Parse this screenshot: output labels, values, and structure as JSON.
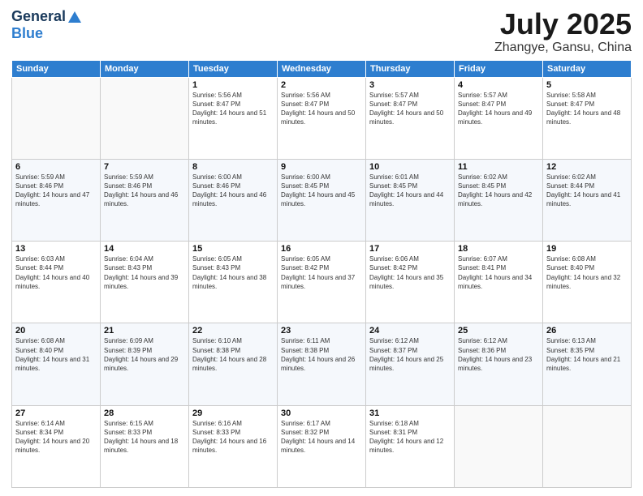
{
  "logo": {
    "general": "General",
    "blue": "Blue"
  },
  "title": {
    "month": "July 2025",
    "location": "Zhangye, Gansu, China"
  },
  "weekdays": [
    "Sunday",
    "Monday",
    "Tuesday",
    "Wednesday",
    "Thursday",
    "Friday",
    "Saturday"
  ],
  "weeks": [
    [
      {
        "day": "",
        "sunrise": "",
        "sunset": "",
        "daylight": ""
      },
      {
        "day": "",
        "sunrise": "",
        "sunset": "",
        "daylight": ""
      },
      {
        "day": "1",
        "sunrise": "Sunrise: 5:56 AM",
        "sunset": "Sunset: 8:47 PM",
        "daylight": "Daylight: 14 hours and 51 minutes."
      },
      {
        "day": "2",
        "sunrise": "Sunrise: 5:56 AM",
        "sunset": "Sunset: 8:47 PM",
        "daylight": "Daylight: 14 hours and 50 minutes."
      },
      {
        "day": "3",
        "sunrise": "Sunrise: 5:57 AM",
        "sunset": "Sunset: 8:47 PM",
        "daylight": "Daylight: 14 hours and 50 minutes."
      },
      {
        "day": "4",
        "sunrise": "Sunrise: 5:57 AM",
        "sunset": "Sunset: 8:47 PM",
        "daylight": "Daylight: 14 hours and 49 minutes."
      },
      {
        "day": "5",
        "sunrise": "Sunrise: 5:58 AM",
        "sunset": "Sunset: 8:47 PM",
        "daylight": "Daylight: 14 hours and 48 minutes."
      }
    ],
    [
      {
        "day": "6",
        "sunrise": "Sunrise: 5:59 AM",
        "sunset": "Sunset: 8:46 PM",
        "daylight": "Daylight: 14 hours and 47 minutes."
      },
      {
        "day": "7",
        "sunrise": "Sunrise: 5:59 AM",
        "sunset": "Sunset: 8:46 PM",
        "daylight": "Daylight: 14 hours and 46 minutes."
      },
      {
        "day": "8",
        "sunrise": "Sunrise: 6:00 AM",
        "sunset": "Sunset: 8:46 PM",
        "daylight": "Daylight: 14 hours and 46 minutes."
      },
      {
        "day": "9",
        "sunrise": "Sunrise: 6:00 AM",
        "sunset": "Sunset: 8:45 PM",
        "daylight": "Daylight: 14 hours and 45 minutes."
      },
      {
        "day": "10",
        "sunrise": "Sunrise: 6:01 AM",
        "sunset": "Sunset: 8:45 PM",
        "daylight": "Daylight: 14 hours and 44 minutes."
      },
      {
        "day": "11",
        "sunrise": "Sunrise: 6:02 AM",
        "sunset": "Sunset: 8:45 PM",
        "daylight": "Daylight: 14 hours and 42 minutes."
      },
      {
        "day": "12",
        "sunrise": "Sunrise: 6:02 AM",
        "sunset": "Sunset: 8:44 PM",
        "daylight": "Daylight: 14 hours and 41 minutes."
      }
    ],
    [
      {
        "day": "13",
        "sunrise": "Sunrise: 6:03 AM",
        "sunset": "Sunset: 8:44 PM",
        "daylight": "Daylight: 14 hours and 40 minutes."
      },
      {
        "day": "14",
        "sunrise": "Sunrise: 6:04 AM",
        "sunset": "Sunset: 8:43 PM",
        "daylight": "Daylight: 14 hours and 39 minutes."
      },
      {
        "day": "15",
        "sunrise": "Sunrise: 6:05 AM",
        "sunset": "Sunset: 8:43 PM",
        "daylight": "Daylight: 14 hours and 38 minutes."
      },
      {
        "day": "16",
        "sunrise": "Sunrise: 6:05 AM",
        "sunset": "Sunset: 8:42 PM",
        "daylight": "Daylight: 14 hours and 37 minutes."
      },
      {
        "day": "17",
        "sunrise": "Sunrise: 6:06 AM",
        "sunset": "Sunset: 8:42 PM",
        "daylight": "Daylight: 14 hours and 35 minutes."
      },
      {
        "day": "18",
        "sunrise": "Sunrise: 6:07 AM",
        "sunset": "Sunset: 8:41 PM",
        "daylight": "Daylight: 14 hours and 34 minutes."
      },
      {
        "day": "19",
        "sunrise": "Sunrise: 6:08 AM",
        "sunset": "Sunset: 8:40 PM",
        "daylight": "Daylight: 14 hours and 32 minutes."
      }
    ],
    [
      {
        "day": "20",
        "sunrise": "Sunrise: 6:08 AM",
        "sunset": "Sunset: 8:40 PM",
        "daylight": "Daylight: 14 hours and 31 minutes."
      },
      {
        "day": "21",
        "sunrise": "Sunrise: 6:09 AM",
        "sunset": "Sunset: 8:39 PM",
        "daylight": "Daylight: 14 hours and 29 minutes."
      },
      {
        "day": "22",
        "sunrise": "Sunrise: 6:10 AM",
        "sunset": "Sunset: 8:38 PM",
        "daylight": "Daylight: 14 hours and 28 minutes."
      },
      {
        "day": "23",
        "sunrise": "Sunrise: 6:11 AM",
        "sunset": "Sunset: 8:38 PM",
        "daylight": "Daylight: 14 hours and 26 minutes."
      },
      {
        "day": "24",
        "sunrise": "Sunrise: 6:12 AM",
        "sunset": "Sunset: 8:37 PM",
        "daylight": "Daylight: 14 hours and 25 minutes."
      },
      {
        "day": "25",
        "sunrise": "Sunrise: 6:12 AM",
        "sunset": "Sunset: 8:36 PM",
        "daylight": "Daylight: 14 hours and 23 minutes."
      },
      {
        "day": "26",
        "sunrise": "Sunrise: 6:13 AM",
        "sunset": "Sunset: 8:35 PM",
        "daylight": "Daylight: 14 hours and 21 minutes."
      }
    ],
    [
      {
        "day": "27",
        "sunrise": "Sunrise: 6:14 AM",
        "sunset": "Sunset: 8:34 PM",
        "daylight": "Daylight: 14 hours and 20 minutes."
      },
      {
        "day": "28",
        "sunrise": "Sunrise: 6:15 AM",
        "sunset": "Sunset: 8:33 PM",
        "daylight": "Daylight: 14 hours and 18 minutes."
      },
      {
        "day": "29",
        "sunrise": "Sunrise: 6:16 AM",
        "sunset": "Sunset: 8:33 PM",
        "daylight": "Daylight: 14 hours and 16 minutes."
      },
      {
        "day": "30",
        "sunrise": "Sunrise: 6:17 AM",
        "sunset": "Sunset: 8:32 PM",
        "daylight": "Daylight: 14 hours and 14 minutes."
      },
      {
        "day": "31",
        "sunrise": "Sunrise: 6:18 AM",
        "sunset": "Sunset: 8:31 PM",
        "daylight": "Daylight: 14 hours and 12 minutes."
      },
      {
        "day": "",
        "sunrise": "",
        "sunset": "",
        "daylight": ""
      },
      {
        "day": "",
        "sunrise": "",
        "sunset": "",
        "daylight": ""
      }
    ]
  ]
}
